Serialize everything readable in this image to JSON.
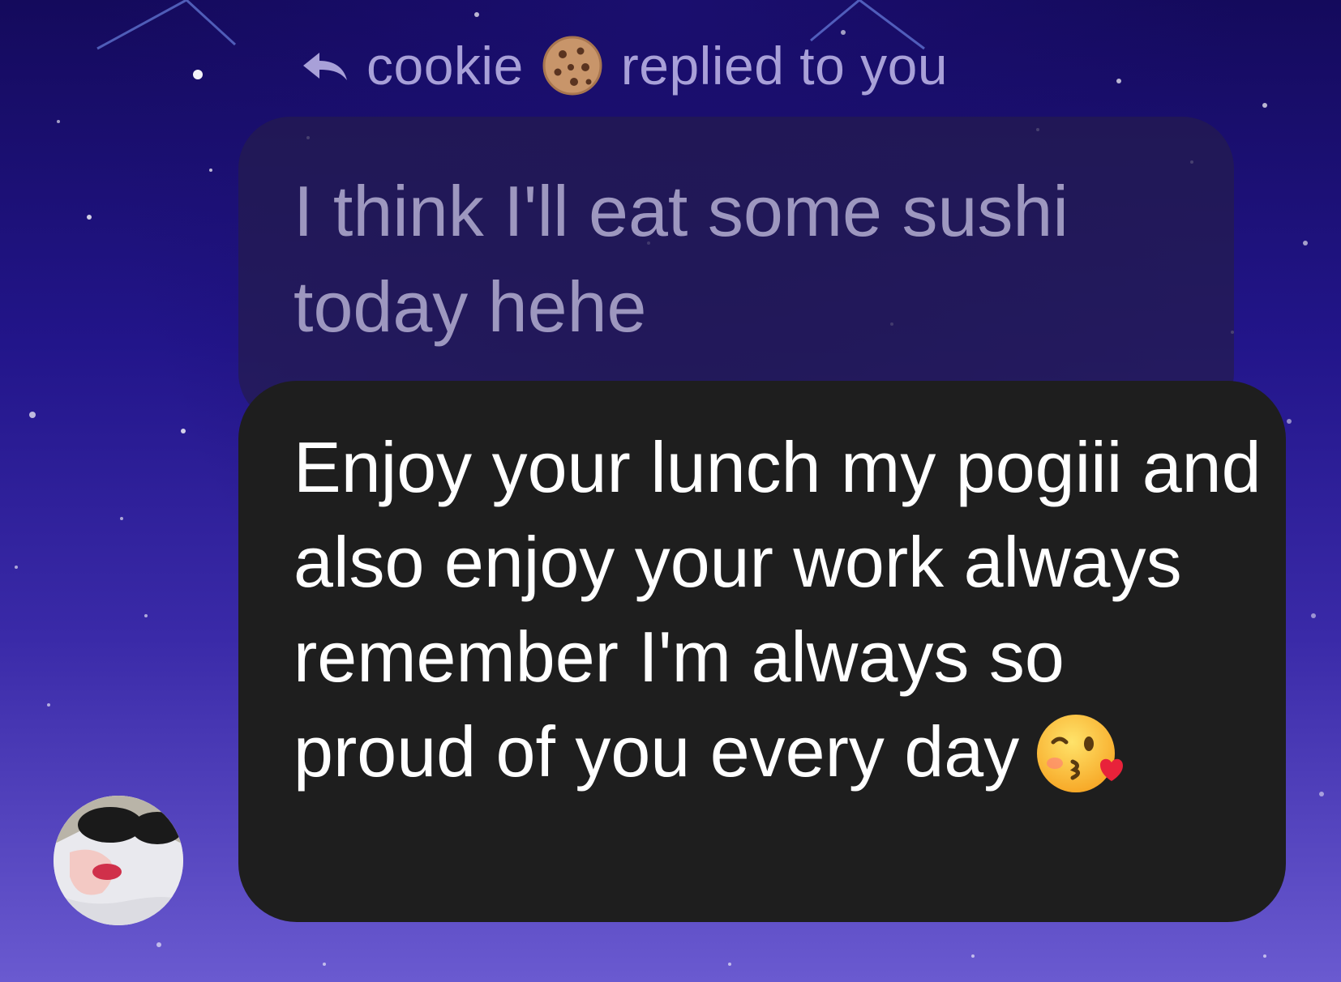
{
  "reply_header": {
    "sender": "cookie",
    "sender_emoji": "cookie-emoji",
    "action_text": "replied to you",
    "icon": "reply-arrow-icon"
  },
  "quoted_message": {
    "text": "I think I'll eat some sushi today hehe"
  },
  "message": {
    "text": "Enjoy your lunch my pogiii and also enjoy your work always remember I'm always so proud of you every day",
    "emoji": "face-blowing-kiss-emoji"
  },
  "avatar": {
    "icon": "user-avatar"
  },
  "colors": {
    "background_top": "#140a5c",
    "background_bottom": "#6a5ad0",
    "message_bubble": "#1e1e1e",
    "quoted_bubble": "#241c4e",
    "header_text": "#a8a0d8"
  }
}
